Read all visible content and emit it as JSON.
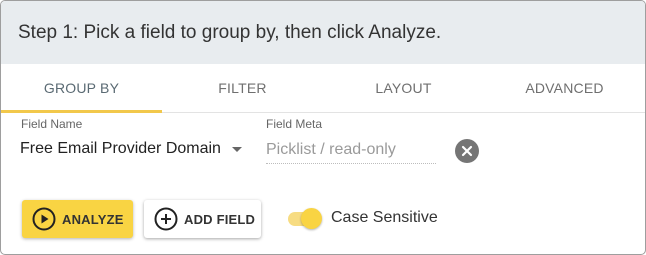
{
  "header": {
    "title": "Step 1: Pick a field to group by, then click Analyze."
  },
  "tabs": [
    {
      "label": "GROUP BY",
      "active": true
    },
    {
      "label": "FILTER",
      "active": false
    },
    {
      "label": "LAYOUT",
      "active": false
    },
    {
      "label": "ADVANCED",
      "active": false
    }
  ],
  "field_name": {
    "label": "Field Name",
    "value": "Free Email Provider Domain"
  },
  "field_meta": {
    "label": "Field Meta",
    "value": "Picklist / read-only"
  },
  "actions": {
    "analyze_label": "ANALYZE",
    "add_field_label": "ADD FIELD",
    "case_sensitive_label": "Case Sensitive",
    "case_sensitive_on": true
  },
  "colors": {
    "accent": "#f9d443",
    "header_bg": "#e8ecef",
    "tab_indicator": "#f2c84b"
  },
  "icons": {
    "analyze": "play-circle-icon",
    "add_field": "plus-circle-icon",
    "clear": "close-circle-icon",
    "dropdown": "caret-down-icon"
  }
}
